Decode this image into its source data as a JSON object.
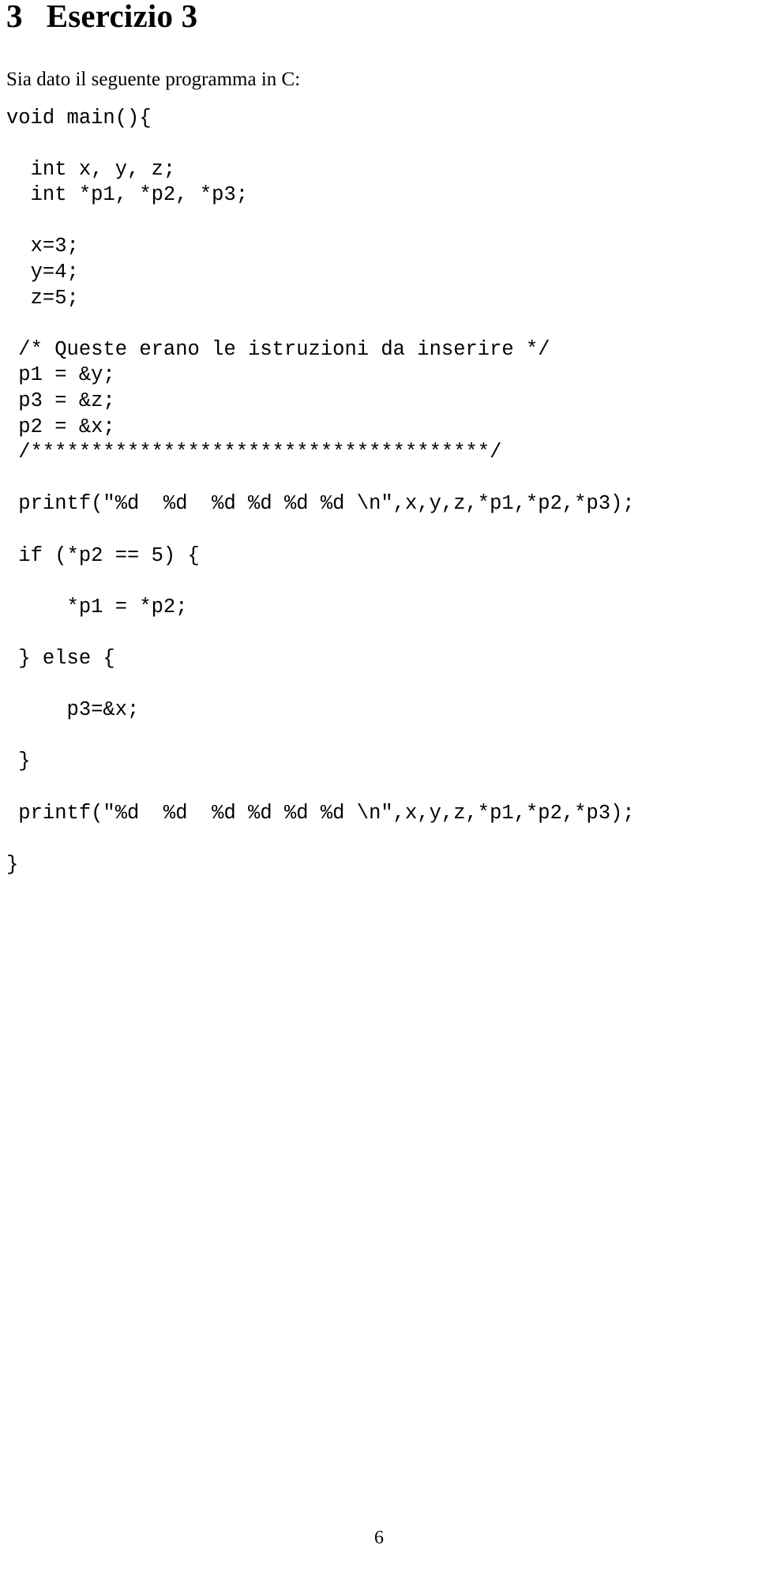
{
  "document": {
    "heading": {
      "number": "3",
      "title": "Esercizio 3"
    },
    "intro_text": "Sia dato il seguente programma in C:",
    "page_number": "6",
    "code_listing": {
      "language": "C",
      "lines": [
        "void main(){",
        "",
        "  int x, y, z;",
        "  int *p1, *p2, *p3;",
        "",
        "  x=3;",
        "  y=4;",
        "  z=5;",
        "",
        " /* Queste erano le istruzioni da inserire */",
        " p1 = &y;",
        " p3 = &z;",
        " p2 = &x;",
        " /**************************************/",
        "",
        " printf(\"%d  %d  %d %d %d %d \\n\",x,y,z,*p1,*p2,*p3);",
        "",
        " if (*p2 == 5) {",
        "",
        "     *p1 = *p2;",
        "",
        " } else {",
        "",
        "     p3=&x;",
        "",
        " }",
        "",
        " printf(\"%d  %d  %d %d %d %d \\n\",x,y,z,*p1,*p2,*p3);",
        "",
        "}"
      ]
    }
  }
}
